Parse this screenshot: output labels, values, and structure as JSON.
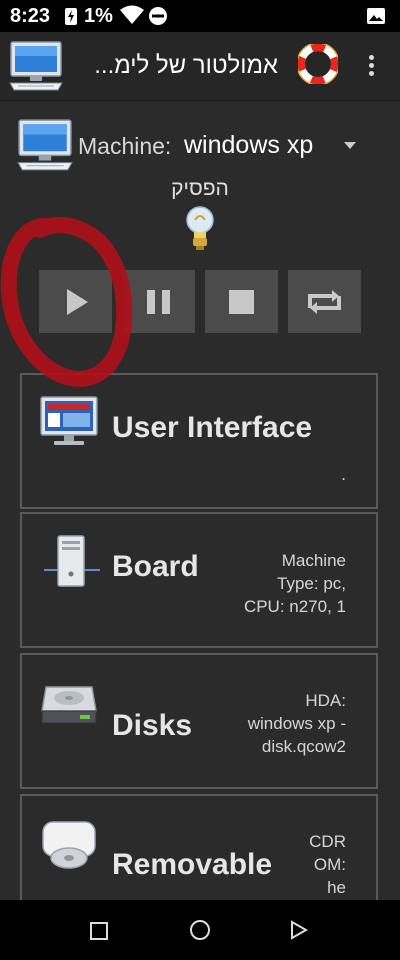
{
  "status_bar": {
    "time": "8:23",
    "battery": "1%"
  },
  "app_bar": {
    "title": "אמולטור של לימ...",
    "logo_icon": "computer-icon",
    "help_icon": "lifebuoy-icon",
    "menu_icon": "overflow-menu-icon"
  },
  "machine": {
    "label": "Machine:",
    "value": "windows xp",
    "status": "הפסיק"
  },
  "controls": [
    {
      "name": "play",
      "icon": "play-icon"
    },
    {
      "name": "pause",
      "icon": "pause-icon"
    },
    {
      "name": "stop",
      "icon": "stop-icon"
    },
    {
      "name": "restart",
      "icon": "restart-icon"
    }
  ],
  "cards": [
    {
      "label": "User Interface",
      "detail": [
        "."
      ]
    },
    {
      "label": "Board",
      "detail": [
        "Machine",
        "Type: pc,",
        "CPU: n270, 1"
      ]
    },
    {
      "label": "Disks",
      "detail": [
        "HDA:",
        "windows xp -",
        "disk.qcow2"
      ]
    },
    {
      "label": "Removable",
      "detail": [
        "CDR",
        "OM:",
        "he"
      ]
    }
  ],
  "colors": {
    "background": "#2b2b2b",
    "button": "#4b4b4b",
    "annotation": "#b0101a"
  }
}
